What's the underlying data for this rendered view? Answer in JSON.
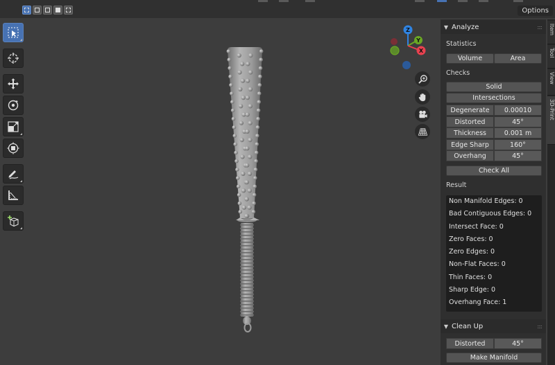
{
  "header": {
    "options_label": "Options"
  },
  "tools": [
    "select-box-icon",
    "cursor-icon",
    "move-icon",
    "rotate-icon",
    "scale-icon",
    "transform-icon",
    "annotate-icon",
    "measure-icon",
    "add-cube-icon"
  ],
  "gizmo": {
    "z": "Z",
    "y": "Y",
    "x": "X"
  },
  "nav_buttons": [
    "zoom-icon",
    "hand-pan-icon",
    "camera-icon",
    "perspective-grid-icon"
  ],
  "colors": {
    "accent": "#4772b3",
    "axis_x": "#e8414f",
    "axis_y": "#6ba824",
    "axis_z": "#2f84e3"
  },
  "analyze": {
    "title": "Analyze",
    "statistics_label": "Statistics",
    "volume_btn": "Volume",
    "area_btn": "Area",
    "checks_label": "Checks",
    "solid_btn": "Solid",
    "intersections_btn": "Intersections",
    "checks": [
      {
        "label": "Degenerate",
        "value": "0.00010"
      },
      {
        "label": "Distorted",
        "value": "45°"
      },
      {
        "label": "Thickness",
        "value": "0.001 m"
      },
      {
        "label": "Edge Sharp",
        "value": "160°"
      },
      {
        "label": "Overhang",
        "value": "45°"
      }
    ],
    "check_all_btn": "Check All",
    "result_label": "Result",
    "results": [
      "Non Manifold Edges: 0",
      "Bad Contiguous Edges: 0",
      "Intersect Face: 0",
      "Zero Faces: 0",
      "Zero Edges: 0",
      "Non-Flat Faces: 0",
      "Thin Faces: 0",
      "Sharp Edge: 0",
      "Overhang Face: 1"
    ]
  },
  "cleanup": {
    "title": "Clean Up",
    "distorted_label": "Distorted",
    "distorted_value": "45°",
    "make_manifold_btn": "Make Manifold"
  },
  "tabs": [
    "Item",
    "Tool",
    "View",
    "3D-Print"
  ]
}
